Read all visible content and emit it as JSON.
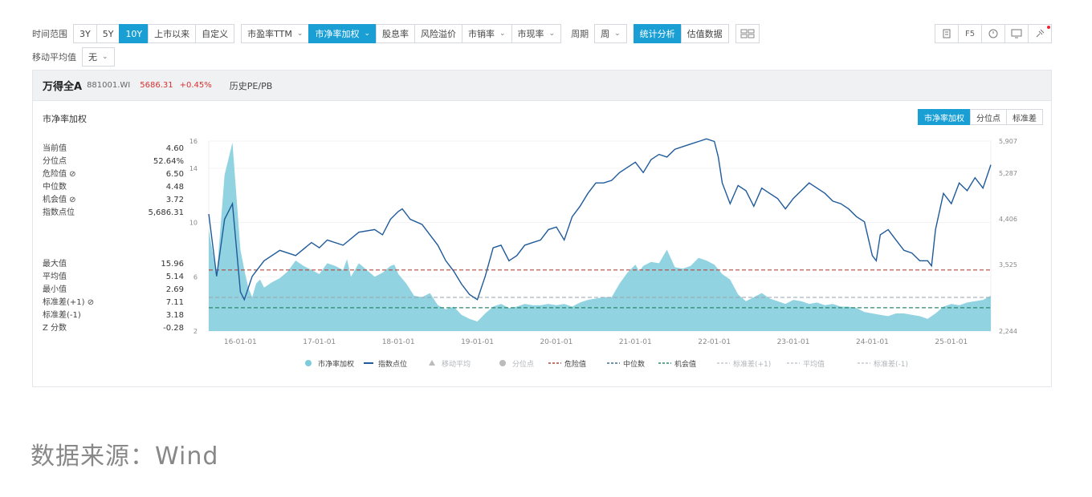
{
  "toolbar": {
    "range_label": "时间范围",
    "range_buttons": [
      "3Y",
      "5Y",
      "10Y",
      "上市以来",
      "自定义"
    ],
    "range_active": "10Y",
    "metric_pe": "市盈率TTM",
    "metric_pb": "市净率加权",
    "metric_others": [
      "股息率",
      "风险溢价",
      "市销率",
      "市现率"
    ],
    "period_label": "周期",
    "period_value": "周",
    "analysis_btn": "统计分析",
    "data_btn": "估值数据",
    "ma_label": "移动平均值",
    "ma_value": "无",
    "right_icons": [
      "export-icon",
      "f5-icon",
      "clock-icon",
      "monitor-icon",
      "pin-icon"
    ],
    "f5_text": "F5"
  },
  "header": {
    "name": "万得全A",
    "code": "881001.WI",
    "price": "5686.31",
    "change": "+0.45%",
    "hist": "历史PE/PB"
  },
  "panel": {
    "subtitle": "市净率加权",
    "seg_buttons": [
      "市净率加权",
      "分位点",
      "标准差"
    ]
  },
  "stats_top": [
    {
      "k": "当前值",
      "v": "4.60"
    },
    {
      "k": "分位点",
      "v": "52.64%"
    },
    {
      "k": "危险值 ⊘",
      "v": "6.50"
    },
    {
      "k": "中位数",
      "v": "4.48"
    },
    {
      "k": "机会值 ⊘",
      "v": "3.72"
    },
    {
      "k": "指数点位",
      "v": "5,686.31"
    }
  ],
  "stats_bottom": [
    {
      "k": "最大值",
      "v": "15.96"
    },
    {
      "k": "平均值",
      "v": "5.14"
    },
    {
      "k": "最小值",
      "v": "2.69"
    },
    {
      "k": "标准差(+1) ⊘",
      "v": "7.11"
    },
    {
      "k": "标准差(-1)",
      "v": "3.18"
    },
    {
      "k": "Z 分数",
      "v": "-0.28"
    }
  ],
  "source": "数据来源：Wind",
  "colors": {
    "area": "#7ecbdc",
    "line": "#1f5a9a",
    "danger": "#b5473e",
    "median": "#3d6e8f",
    "opportunity": "#2a8a6a",
    "std": "#9aa3ad",
    "accent": "#1a9fd5"
  },
  "chart_data": {
    "type": "area",
    "x_tick_labels": [
      "16-01-01",
      "17-01-01",
      "18-01-01",
      "19-01-01",
      "20-01-01",
      "21-01-01",
      "22-01-01",
      "23-01-01",
      "24-01-01",
      "25-01-01"
    ],
    "y_left_ticks": [
      "2",
      "6",
      "10",
      "14",
      "16"
    ],
    "y_right_ticks": [
      "2,244",
      "3,525",
      "4,406",
      "5,287",
      "5,907"
    ],
    "danger_value": 6.5,
    "median_value": 4.48,
    "opportunity_value": 3.72,
    "legend": [
      "市净率加权",
      "指数点位",
      "移动平均",
      "分位点",
      "危险值",
      "中位数",
      "机会值",
      "标准差(+1)",
      "平均值",
      "标准差(-1)"
    ],
    "series": [
      {
        "name": "市净率加权",
        "x": [
          2015.6,
          2015.7,
          2015.8,
          2015.9,
          2016.0,
          2016.05,
          2016.1,
          2016.15,
          2016.2,
          2016.25,
          2016.3,
          2016.4,
          2016.5,
          2016.6,
          2016.7,
          2016.8,
          2016.9,
          2017.0,
          2017.1,
          2017.2,
          2017.3,
          2017.35,
          2017.4,
          2017.5,
          2017.6,
          2017.7,
          2017.8,
          2017.9,
          2017.95,
          2018.0,
          2018.1,
          2018.2,
          2018.3,
          2018.4,
          2018.5,
          2018.6,
          2018.7,
          2018.8,
          2018.9,
          2019.0,
          2019.1,
          2019.2,
          2019.3,
          2019.4,
          2019.5,
          2019.6,
          2019.7,
          2019.8,
          2019.9,
          2020.0,
          2020.1,
          2020.2,
          2020.3,
          2020.4,
          2020.5,
          2020.6,
          2020.7,
          2020.8,
          2020.9,
          2021.0,
          2021.05,
          2021.1,
          2021.2,
          2021.3,
          2021.4,
          2021.5,
          2021.6,
          2021.7,
          2021.8,
          2021.9,
          2022.0,
          2022.1,
          2022.2,
          2022.3,
          2022.4,
          2022.5,
          2022.6,
          2022.7,
          2022.8,
          2022.9,
          2023.0,
          2023.1,
          2023.2,
          2023.3,
          2023.4,
          2023.5,
          2023.6,
          2023.7,
          2023.8,
          2023.9,
          2024.0,
          2024.1,
          2024.2,
          2024.3,
          2024.4,
          2024.5,
          2024.6,
          2024.7,
          2024.8,
          2024.9,
          2025.0,
          2025.1,
          2025.2,
          2025.3,
          2025.4,
          2025.5
        ],
        "values": [
          9.5,
          6.0,
          13.5,
          15.9,
          8.0,
          6.5,
          5.2,
          4.5,
          5.5,
          5.8,
          5.2,
          5.6,
          5.9,
          6.4,
          7.2,
          6.8,
          6.5,
          6.2,
          7.0,
          6.8,
          6.5,
          7.3,
          6.0,
          7.0,
          6.5,
          6.0,
          6.3,
          6.8,
          6.9,
          6.2,
          5.5,
          4.6,
          4.5,
          4.8,
          3.9,
          3.6,
          3.8,
          3.2,
          2.9,
          2.7,
          3.3,
          3.8,
          4.0,
          3.7,
          3.8,
          4.0,
          3.9,
          3.9,
          4.0,
          3.9,
          4.0,
          3.8,
          4.1,
          4.3,
          4.4,
          4.5,
          4.5,
          5.5,
          6.3,
          6.9,
          6.4,
          6.8,
          7.1,
          7.0,
          8.0,
          6.7,
          6.6,
          6.8,
          7.4,
          7.2,
          6.9,
          6.2,
          5.8,
          4.7,
          4.2,
          4.5,
          4.8,
          4.4,
          4.2,
          4.0,
          4.3,
          4.2,
          4.0,
          4.1,
          3.9,
          4.0,
          3.8,
          3.8,
          3.7,
          3.4,
          3.3,
          3.2,
          3.1,
          3.3,
          3.3,
          3.2,
          3.1,
          2.9,
          3.3,
          3.8,
          4.0,
          3.9,
          4.1,
          4.2,
          4.3,
          4.6
        ]
      },
      {
        "name": "指数点位",
        "x": [
          2015.6,
          2015.7,
          2015.8,
          2015.9,
          2016.0,
          2016.05,
          2016.15,
          2016.3,
          2016.5,
          2016.7,
          2016.9,
          2017.0,
          2017.1,
          2017.3,
          2017.5,
          2017.7,
          2017.8,
          2017.9,
          2018.0,
          2018.05,
          2018.15,
          2018.3,
          2018.5,
          2018.6,
          2018.7,
          2018.8,
          2018.9,
          2019.0,
          2019.1,
          2019.2,
          2019.3,
          2019.4,
          2019.5,
          2019.6,
          2019.7,
          2019.8,
          2019.9,
          2020.0,
          2020.1,
          2020.2,
          2020.3,
          2020.4,
          2020.5,
          2020.6,
          2020.7,
          2020.8,
          2020.9,
          2021.0,
          2021.1,
          2021.2,
          2021.3,
          2021.4,
          2021.5,
          2021.6,
          2021.7,
          2021.8,
          2021.9,
          2022.0,
          2022.05,
          2022.1,
          2022.2,
          2022.3,
          2022.4,
          2022.5,
          2022.6,
          2022.7,
          2022.8,
          2022.9,
          2023.0,
          2023.1,
          2023.2,
          2023.3,
          2023.4,
          2023.5,
          2023.6,
          2023.7,
          2023.8,
          2023.9,
          2024.0,
          2024.05,
          2024.1,
          2024.2,
          2024.3,
          2024.4,
          2024.5,
          2024.6,
          2024.7,
          2024.75,
          2024.8,
          2024.9,
          2025.0,
          2025.1,
          2025.2,
          2025.3,
          2025.4,
          2025.5
        ],
        "values": [
          4500,
          3300,
          4400,
          4700,
          3000,
          2850,
          3300,
          3600,
          3800,
          3700,
          3950,
          3850,
          4000,
          3900,
          4150,
          4200,
          4100,
          4400,
          4550,
          4600,
          4400,
          4300,
          3900,
          3600,
          3400,
          3150,
          2950,
          2850,
          3300,
          3850,
          3900,
          3600,
          3700,
          3900,
          3950,
          4000,
          4200,
          4250,
          4000,
          4450,
          4650,
          4900,
          5100,
          5100,
          5150,
          5300,
          5400,
          5500,
          5300,
          5550,
          5650,
          5600,
          5750,
          5800,
          5850,
          5900,
          5950,
          5900,
          5600,
          5100,
          4700,
          5050,
          4950,
          4650,
          5000,
          4900,
          4800,
          4600,
          4800,
          4950,
          5100,
          5000,
          4900,
          4750,
          4700,
          4600,
          4450,
          4350,
          3700,
          3600,
          4100,
          4200,
          4000,
          3800,
          3750,
          3600,
          3600,
          3500,
          4200,
          4900,
          4700,
          5100,
          4950,
          5200,
          5000,
          5450
        ]
      }
    ]
  }
}
